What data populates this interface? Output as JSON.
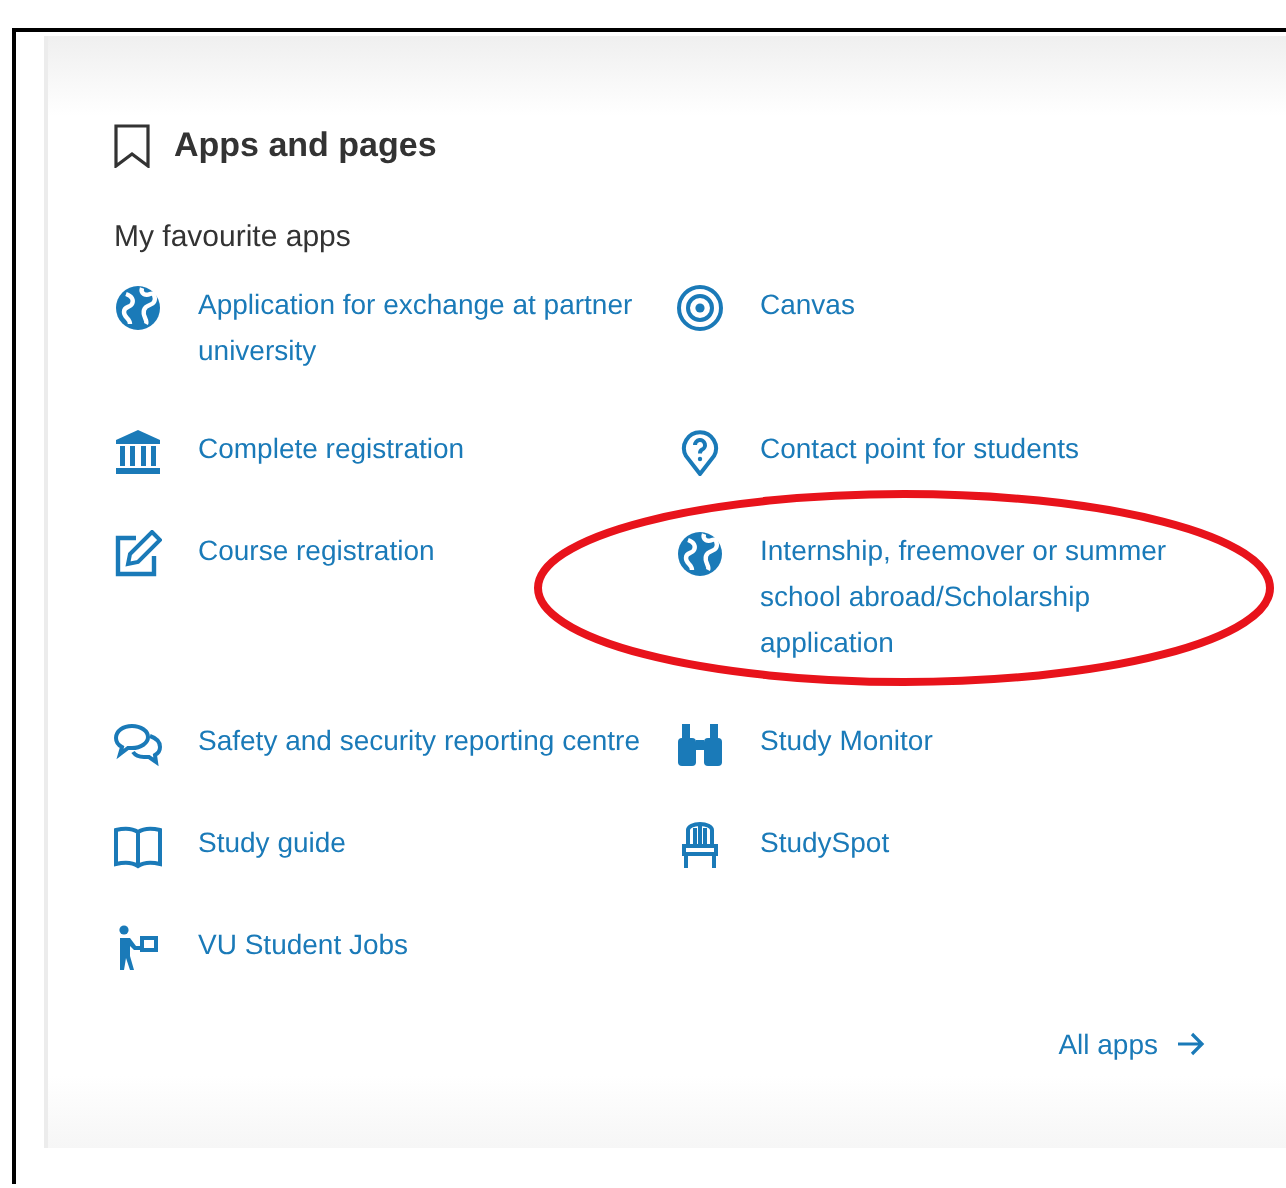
{
  "panel": {
    "title": "Apps and pages",
    "section": "My favourite apps",
    "apps": [
      {
        "label": "Application for exchange at partner university",
        "circled": false
      },
      {
        "label": "Canvas",
        "circled": false
      },
      {
        "label": "Complete registration",
        "circled": false
      },
      {
        "label": "Contact point for students",
        "circled": false
      },
      {
        "label": "Course registration",
        "circled": false
      },
      {
        "label": "Internship, freemover or summer school abroad/Scholarship application",
        "circled": true
      },
      {
        "label": "Safety and security reporting centre",
        "circled": false
      },
      {
        "label": "Study Monitor",
        "circled": false
      },
      {
        "label": "Study guide",
        "circled": false
      },
      {
        "label": "StudySpot",
        "circled": false
      },
      {
        "label": "VU Student Jobs",
        "circled": false
      }
    ],
    "all_apps": "All apps"
  }
}
